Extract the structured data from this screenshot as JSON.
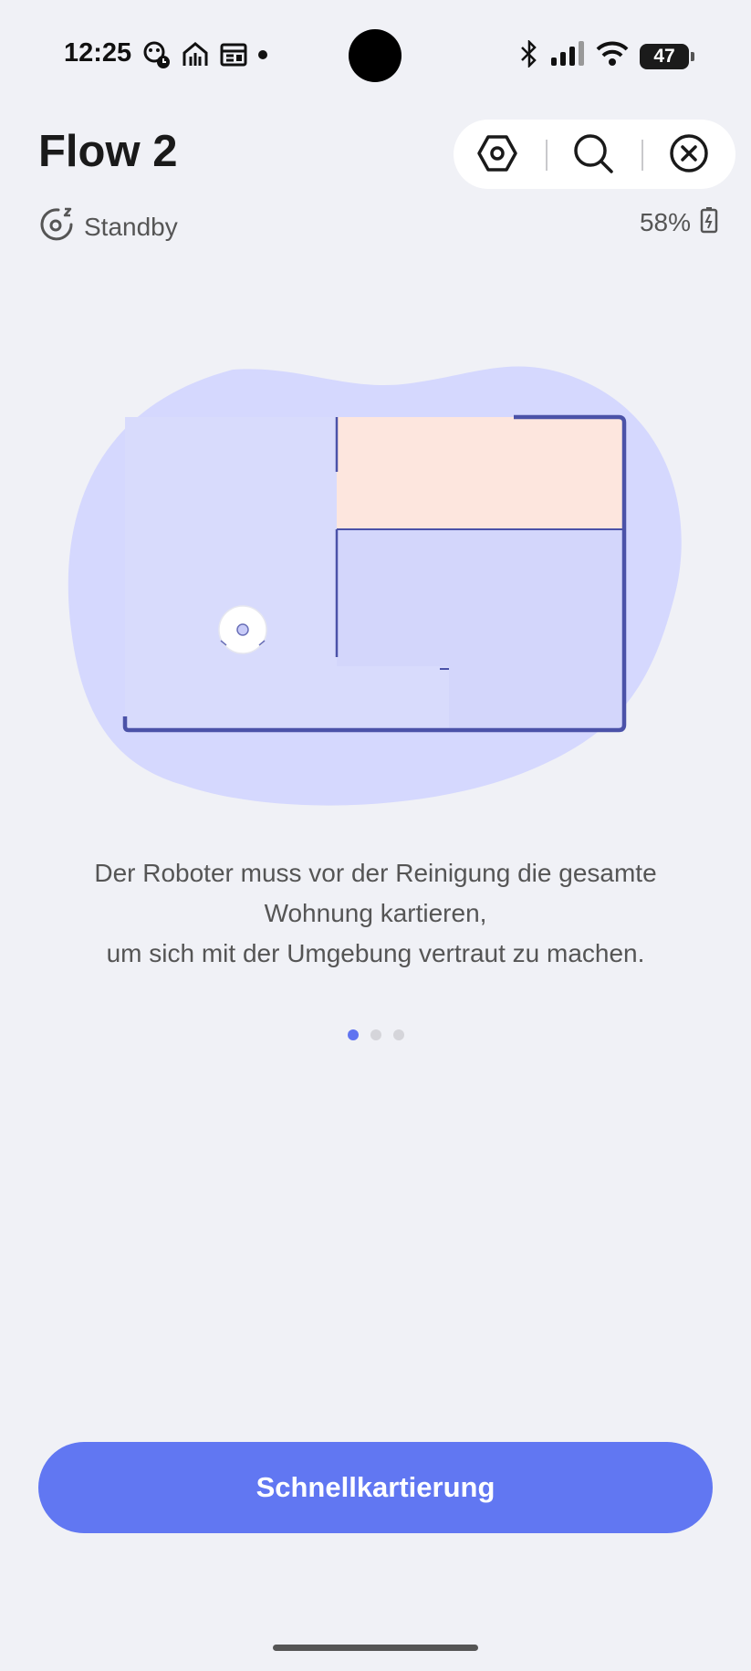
{
  "status_bar": {
    "time": "12:25",
    "battery_level": "47",
    "icons": [
      "monkey-clock-icon",
      "food-delivery-icon",
      "news-icon",
      "dot-icon",
      "bluetooth-icon",
      "signal-icon",
      "wifi-icon"
    ]
  },
  "header": {
    "title": "Flow 2",
    "toolbar": {
      "settings_icon": "hexagon-settings-icon",
      "search_icon": "search-icon",
      "close_icon": "close-circle-icon"
    }
  },
  "device_status": {
    "state": "Standby",
    "battery": "58%"
  },
  "onboarding": {
    "description_lines": [
      "Der Roboter muss vor der Reinigung die gesamte",
      "Wohnung kartieren,",
      "um sich mit der Umgebung vertraut zu machen."
    ],
    "page_count": 3,
    "active_page": 0
  },
  "primary_action": {
    "label": "Schnellkartierung"
  },
  "colors": {
    "accent": "#6177f2",
    "blob": "#d5d8fe",
    "room_highlight": "#fde6de",
    "walls": "#4b52a8"
  }
}
